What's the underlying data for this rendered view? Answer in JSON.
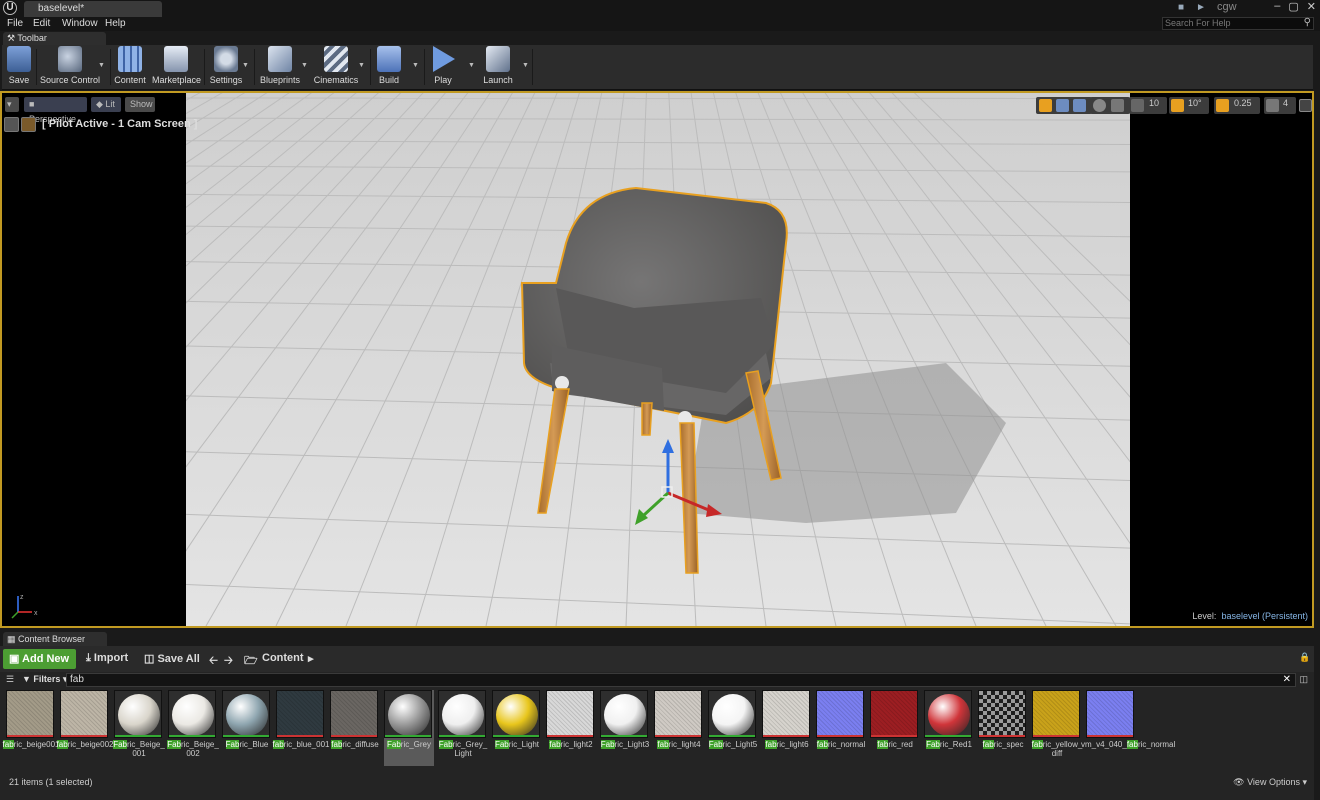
{
  "app": {
    "logo": "U",
    "document_tab": "baselevel*",
    "user": "cgw",
    "window_controls": [
      "–",
      "▢",
      "✕"
    ]
  },
  "menu": [
    "File",
    "Edit",
    "Window",
    "Help"
  ],
  "search_help": {
    "placeholder": "Search For Help"
  },
  "toolbar_tab": "Toolbar",
  "toolbar": [
    {
      "id": "save",
      "label": "Save",
      "icon": "save-icon",
      "color": "#5a7fb5"
    },
    {
      "id": "source_control",
      "label": "Source Control",
      "icon": "source-control-icon",
      "color": "#7a8aa0"
    },
    {
      "id": "content",
      "label": "Content",
      "icon": "content-icon",
      "color": "#6c8fc8"
    },
    {
      "id": "marketplace",
      "label": "Marketplace",
      "icon": "marketplace-icon",
      "color": "#9aa9c0"
    },
    {
      "id": "settings",
      "label": "Settings",
      "icon": "settings-icon",
      "color": "#8a9ab0"
    },
    {
      "id": "blueprints",
      "label": "Blueprints",
      "icon": "blueprints-icon",
      "color": "#7f95b5"
    },
    {
      "id": "cinematics",
      "label": "Cinematics",
      "icon": "cinematics-icon",
      "color": "#909eb0"
    },
    {
      "id": "build",
      "label": "Build",
      "icon": "build-icon",
      "color": "#6d8cc0"
    },
    {
      "id": "play",
      "label": "Play",
      "icon": "play-icon",
      "color": "#5a86d0"
    },
    {
      "id": "launch",
      "label": "Launch",
      "icon": "launch-icon",
      "color": "#8a9ab5"
    }
  ],
  "viewport": {
    "perspective": "Perspective",
    "lit": "Lit",
    "show": "Show",
    "pilot": "[ Pilot Active - 1 Cam Screen ]",
    "grid_snap": "10",
    "rotation_snap": "10°",
    "scale_snap": "0.25",
    "camera_speed": "4",
    "level_label": "Level:",
    "level_name": "baselevel (Persistent)",
    "axis_labels": {
      "z": "z",
      "x": "x",
      "y": "y"
    },
    "selection_color": "#e8a020"
  },
  "content_browser": {
    "tab": "Content Browser",
    "add_new": "Add New",
    "import": "Import",
    "save_all": "Save All",
    "path": "Content",
    "filters": "Filters",
    "filter_text": "fab",
    "status": "21 items (1 selected)",
    "view_options": "View Options",
    "assets": [
      {
        "pre": "",
        "match": "fab",
        "post": "ric_beige001",
        "post2": "",
        "color": "#a39b88",
        "kind": "flat",
        "line": "#c33"
      },
      {
        "pre": "",
        "match": "fab",
        "post": "ric_beige002",
        "post2": "",
        "color": "#bdb5a6",
        "kind": "flat",
        "line": "#c33"
      },
      {
        "pre": "",
        "match": "Fab",
        "post": "ric_Beige_",
        "post2": "001",
        "color": "#d9d5cb",
        "kind": "sphere",
        "line": "#3a3"
      },
      {
        "pre": "",
        "match": "Fab",
        "post": "ric_Beige_",
        "post2": "002",
        "color": "#ebe9e4",
        "kind": "sphere",
        "line": "#3a3"
      },
      {
        "pre": "",
        "match": "Fab",
        "post": "ric_Blue",
        "post2": "",
        "color": "#8fa6b0",
        "kind": "sphere",
        "line": "#3a3"
      },
      {
        "pre": "",
        "match": "fab",
        "post": "ric_blue_001",
        "post2": "",
        "color": "#2f3a40",
        "kind": "flat",
        "line": "#c33"
      },
      {
        "pre": "",
        "match": "fab",
        "post": "ric_diffuse",
        "post2": "",
        "color": "#6a6662",
        "kind": "flat",
        "line": "#c33"
      },
      {
        "pre": "",
        "match": "Fab",
        "post": "ric_Grey",
        "post2": "",
        "color": "#9b9b9b",
        "kind": "sphere",
        "line": "#3a3"
      },
      {
        "pre": "",
        "match": "Fab",
        "post": "ric_Grey_",
        "post2": "Light",
        "color": "#efefef",
        "kind": "sphere",
        "line": "#3a3"
      },
      {
        "pre": "",
        "match": "Fab",
        "post": "ric_Light",
        "post2": "",
        "color": "#e8c61c",
        "kind": "sphere",
        "line": "#3a3"
      },
      {
        "pre": "",
        "match": "fab",
        "post": "ric_light2",
        "post2": "",
        "color": "#d8d8d8",
        "kind": "flat",
        "line": "#c33"
      },
      {
        "pre": "",
        "match": "Fab",
        "post": "ric_Light3",
        "post2": "",
        "color": "#f0f0f0",
        "kind": "sphere",
        "line": "#3a3"
      },
      {
        "pre": "",
        "match": "fab",
        "post": "ric_light4",
        "post2": "",
        "color": "#cfcac4",
        "kind": "flat",
        "line": "#c33"
      },
      {
        "pre": "",
        "match": "Fab",
        "post": "ric_Light5",
        "post2": "",
        "color": "#f4f4f4",
        "kind": "sphere",
        "line": "#3a3"
      },
      {
        "pre": "",
        "match": "fab",
        "post": "ric_light6",
        "post2": "",
        "color": "#d6d3cd",
        "kind": "flat",
        "line": "#c33"
      },
      {
        "pre": "",
        "match": "fab",
        "post": "ric_normal",
        "post2": "",
        "color": "#7b7ff0",
        "kind": "flat",
        "line": "#c33"
      },
      {
        "pre": "",
        "match": "fab",
        "post": "ric_red",
        "post2": "",
        "color": "#9c1e22",
        "kind": "flat",
        "line": "#c33"
      },
      {
        "pre": "",
        "match": "Fab",
        "post": "ric_Red1",
        "post2": "",
        "color": "#d0353a",
        "kind": "sphere",
        "line": "#3a3"
      },
      {
        "pre": "",
        "match": "fab",
        "post": "ric_spec",
        "post2": "",
        "color": "#3a3a3a",
        "kind": "checker",
        "line": "#c33"
      },
      {
        "pre": "",
        "match": "fab",
        "post": "ric_yellow_",
        "post2": "diff",
        "color": "#c9a21a",
        "kind": "flat",
        "line": "#c33"
      },
      {
        "pre": "vm_v4_040_",
        "match": "fab",
        "post": "ric_normal",
        "post2": "",
        "color": "#7b7ff0",
        "kind": "flat",
        "line": "#c33"
      }
    ],
    "selected_index": 7
  }
}
